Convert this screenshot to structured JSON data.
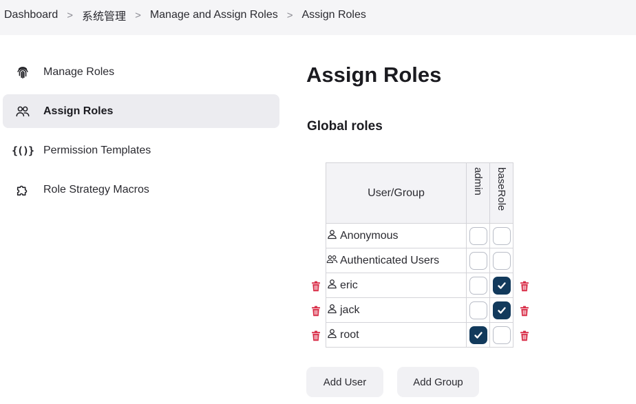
{
  "breadcrumb": [
    "Dashboard",
    "系统管理",
    "Manage and Assign Roles",
    "Assign Roles"
  ],
  "sidebar": {
    "items": [
      {
        "label": "Manage Roles",
        "icon": "fingerprint-icon",
        "active": false
      },
      {
        "label": "Assign Roles",
        "icon": "users-icon",
        "active": true
      },
      {
        "label": "Permission Templates",
        "icon": "braces-icon",
        "active": false
      },
      {
        "label": "Role Strategy Macros",
        "icon": "puzzle-icon",
        "active": false
      }
    ]
  },
  "main": {
    "title": "Assign Roles",
    "section_title": "Global roles",
    "table": {
      "user_header": "User/Group",
      "roles": [
        "admin",
        "baseRole"
      ],
      "rows": [
        {
          "name": "Anonymous",
          "icon": "user-icon",
          "deletable": false,
          "admin": false,
          "baseRole": false
        },
        {
          "name": "Authenticated Users",
          "icon": "users-icon",
          "deletable": false,
          "admin": false,
          "baseRole": false
        },
        {
          "name": "eric",
          "icon": "user-icon",
          "deletable": true,
          "admin": false,
          "baseRole": true
        },
        {
          "name": "jack",
          "icon": "user-icon",
          "deletable": true,
          "admin": false,
          "baseRole": true
        },
        {
          "name": "root",
          "icon": "user-icon",
          "deletable": true,
          "admin": true,
          "baseRole": false
        }
      ]
    },
    "buttons": {
      "add_user": "Add User",
      "add_group": "Add Group"
    }
  },
  "colors": {
    "checked": "#123a5c",
    "trash": "#d9304a",
    "active_bg": "#ececf0"
  }
}
